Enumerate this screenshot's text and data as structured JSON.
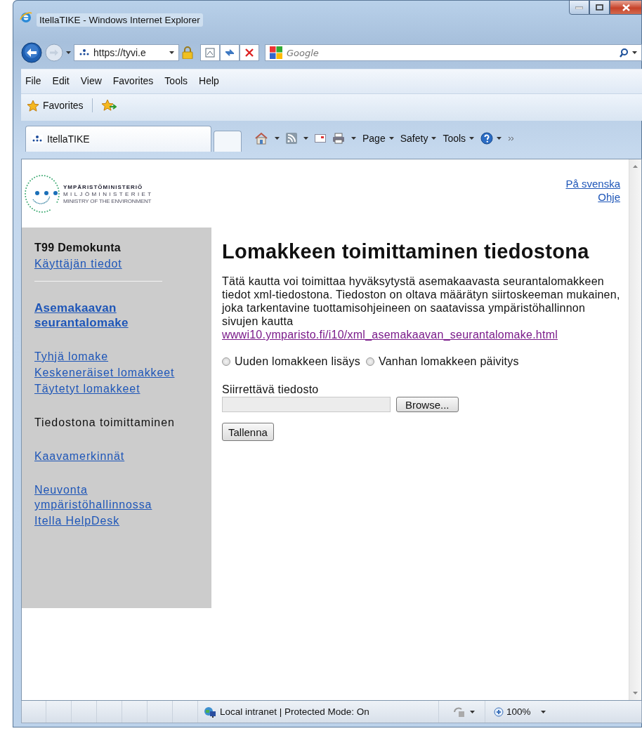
{
  "window": {
    "title": "ItellaTIKE - Windows Internet Explorer"
  },
  "navigation": {
    "address": "https://tyvi.e",
    "search": {
      "placeholder": "Google"
    }
  },
  "menu": [
    "File",
    "Edit",
    "View",
    "Favorites",
    "Tools",
    "Help"
  ],
  "favorites_bar": {
    "label": "Favorites"
  },
  "tabs": [
    {
      "label": "ItellaTIKE",
      "selected": true
    }
  ],
  "command_bar": [
    "Page",
    "Safety",
    "Tools"
  ],
  "page": {
    "logo": {
      "lines": [
        "YMPÄRISTÖMINISTERIÖ",
        "MILJÖMINISTERIET",
        "MINISTRY OF THE ENVIRONMENT"
      ]
    },
    "top_links": [
      "På svenska",
      "Ohje"
    ],
    "sidebar": {
      "groups": [
        [
          {
            "kind": "heading",
            "label": "T99 Demokunta"
          },
          {
            "kind": "link",
            "label": "Käyttäjän tiedot"
          },
          {
            "kind": "divider"
          }
        ],
        [
          {
            "kind": "strong-link",
            "label": "Asemakaavan seurantalomake"
          }
        ],
        [
          {
            "kind": "link",
            "label": "Tyhjä lomake"
          },
          {
            "kind": "link",
            "label": "Keskeneräiset lomakkeet"
          },
          {
            "kind": "link",
            "label": "Täytetyt lomakkeet"
          }
        ],
        [
          {
            "kind": "current",
            "label": "Tiedostona toimittaminen"
          }
        ],
        [
          {
            "kind": "link",
            "label": "Kaavamerkinnät"
          }
        ],
        [
          {
            "kind": "link",
            "label": "Neuvonta ympäristöhallinnossa"
          },
          {
            "kind": "link",
            "label": "Itella HelpDesk"
          }
        ]
      ]
    },
    "heading": "Lomakkeen toimittaminen tiedostona",
    "intro": "Tätä kautta voi toimittaa hyväksytystä asemakaavasta seurantalomakkeen tiedot xml-tiedostona. Tiedoston on oltava määrätyn siirtoskeeman mukainen, joka tarkentavine tuottamisohjeineen on saatavissa ympäristöhallinnon sivujen kautta",
    "link": {
      "label": "wwwi10.ymparisto.fi/i10/xml_asemakaavan_seurantalomake.html",
      "visited": true
    },
    "radios": [
      {
        "label": "Uuden lomakkeen lisäys",
        "selected": false
      },
      {
        "label": "Vanhan lomakkeen päivitys",
        "selected": false
      }
    ],
    "file": {
      "label": "Siirrettävä tiedosto",
      "button": "Browse..."
    },
    "submit": "Tallenna"
  },
  "status_bar": {
    "zone": "Local intranet | Protected Mode: On",
    "zoom": "100%"
  }
}
